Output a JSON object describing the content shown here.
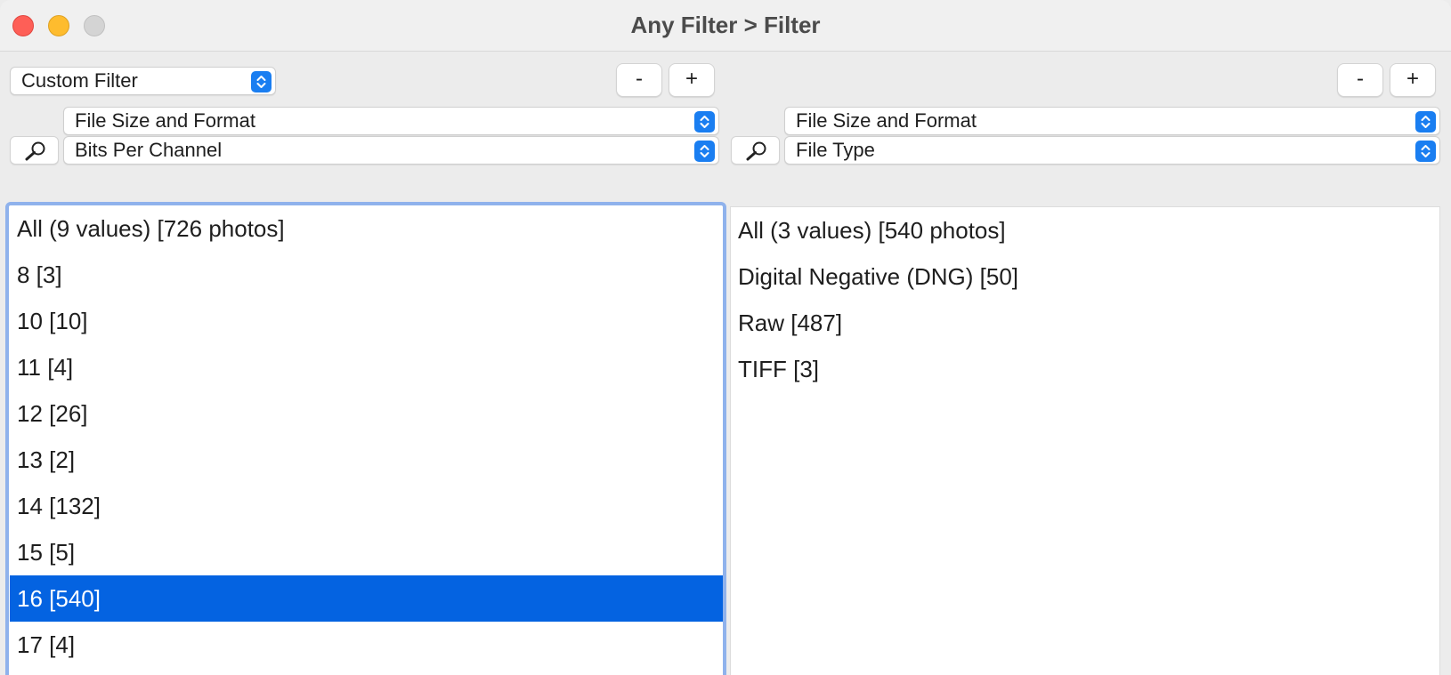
{
  "window": {
    "title": "Any Filter > Filter"
  },
  "left_panel": {
    "filter_type": "Custom Filter",
    "remove_label": "-",
    "add_label": "+",
    "category": "File Size and Format",
    "attribute": "Bits Per Channel",
    "items": [
      {
        "label": "All (9 values) [726 photos]",
        "selected": false
      },
      {
        "label": "8 [3]",
        "selected": false
      },
      {
        "label": "10 [10]",
        "selected": false
      },
      {
        "label": "11 [4]",
        "selected": false
      },
      {
        "label": "12 [26]",
        "selected": false
      },
      {
        "label": "13 [2]",
        "selected": false
      },
      {
        "label": "14 [132]",
        "selected": false
      },
      {
        "label": "15 [5]",
        "selected": false
      },
      {
        "label": "16 [540]",
        "selected": true
      },
      {
        "label": "17 [4]",
        "selected": false
      }
    ]
  },
  "right_panel": {
    "remove_label": "-",
    "add_label": "+",
    "category": "File Size and Format",
    "attribute": "File Type",
    "items": [
      {
        "label": "All (3 values) [540 photos]",
        "selected": false
      },
      {
        "label": "Digital Negative (DNG) [50]",
        "selected": false
      },
      {
        "label": "Raw [487]",
        "selected": false
      },
      {
        "label": "TIFF [3]",
        "selected": false
      }
    ]
  },
  "colors": {
    "selection": "#0463e1",
    "focus_ring": "#8fb2ec",
    "popup_stepper": "#1a7ef1"
  },
  "icons": [
    "close-window-icon",
    "minimize-window-icon",
    "zoom-window-icon",
    "search-icon",
    "popup-stepper-icon"
  ]
}
